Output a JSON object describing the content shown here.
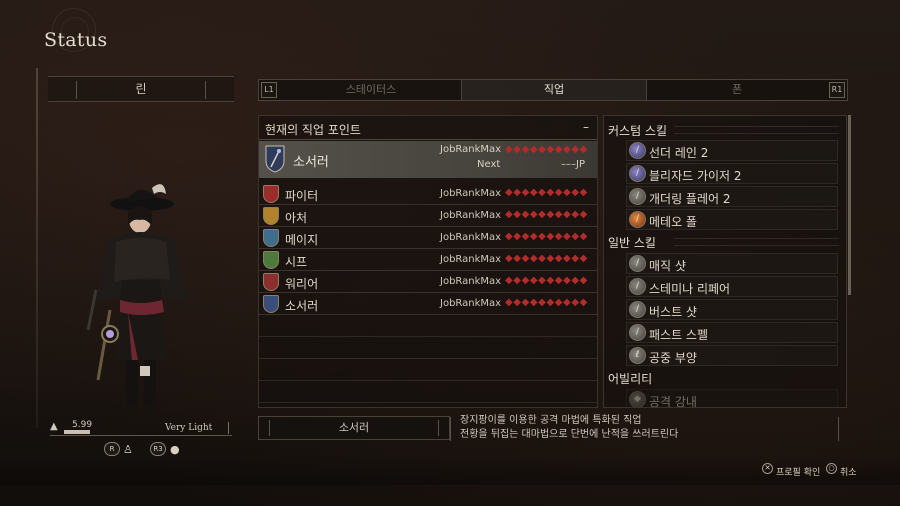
{
  "header": {
    "title": "Status"
  },
  "character": {
    "name": "린",
    "weight_value": "5.99",
    "weight_class": "Very Light",
    "buttons": {
      "r": "R",
      "r3": "R3"
    }
  },
  "tabs": {
    "left_shoulder": "L1",
    "right_shoulder": "R1",
    "items": [
      {
        "label": "스테이터스",
        "active": false
      },
      {
        "label": "직업",
        "active": true
      },
      {
        "label": "폰",
        "active": false
      }
    ]
  },
  "job_panel": {
    "header_label": "현재의 직업 포인트",
    "header_value": "–",
    "current": {
      "name": "소서러",
      "rank_label": "JobRankMax",
      "rank_diamonds": "◆◆◆◆◆◆◆◆◆◆",
      "next_label": "Next",
      "next_value": "–––JP"
    },
    "jobs": [
      {
        "name": "파이터",
        "rank": "JobRankMax",
        "diamonds": "◆◆◆◆◆◆◆◆◆◆",
        "color": "#9c2b2b"
      },
      {
        "name": "아처",
        "rank": "JobRankMax",
        "diamonds": "◆◆◆◆◆◆◆◆◆◆",
        "color": "#b0832c"
      },
      {
        "name": "메이지",
        "rank": "JobRankMax",
        "diamonds": "◆◆◆◆◆◆◆◆◆◆",
        "color": "#3e6e8c"
      },
      {
        "name": "시프",
        "rank": "JobRankMax",
        "diamonds": "◆◆◆◆◆◆◆◆◆◆",
        "color": "#4a7a3e"
      },
      {
        "name": "워리어",
        "rank": "JobRankMax",
        "diamonds": "◆◆◆◆◆◆◆◆◆◆",
        "color": "#8c2e2e"
      },
      {
        "name": "소서러",
        "rank": "JobRankMax",
        "diamonds": "◆◆◆◆◆◆◆◆◆◆",
        "color": "#3a4e7c"
      }
    ]
  },
  "skills": {
    "custom_header": "커스텀 스킬",
    "custom": [
      "선더 레인 2",
      "블리자드 가이저 2",
      "개더링 플레어 2",
      "메테오 폴"
    ],
    "general_header": "일반 스킬",
    "general": [
      "매직 샷",
      "스테미나 리페어",
      "버스트 샷",
      "패스트 스펠",
      "공중 부양"
    ],
    "ability_header": "어빌리티",
    "ability": [
      "공격 강내"
    ]
  },
  "description": {
    "job_name": "소서러",
    "line1": "장지팡이를 이용한 공격 마법에 특화된 직업",
    "line2": "전황을 뒤집는 대마법으로 단번에 난적을 쓰러트린다"
  },
  "footer": {
    "confirm_button": "✕",
    "confirm_label": "프로필 확인",
    "cancel_button": "○",
    "cancel_label": "취소"
  },
  "colors": {
    "accent_red": "#b32c2c",
    "highlight": "#54504a"
  }
}
